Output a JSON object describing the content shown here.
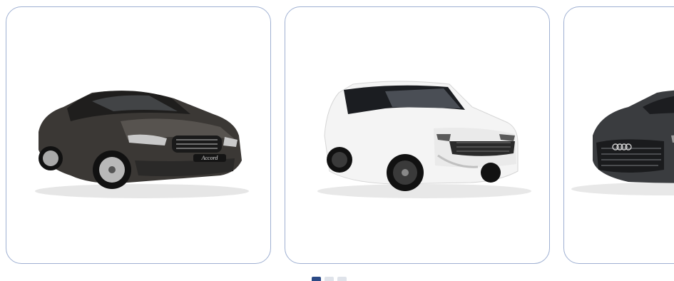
{
  "carousel": {
    "cards": [
      {
        "car": "honda-accord-sedan",
        "color": "#3b3835",
        "badge": "Accord"
      },
      {
        "car": "mitsubishi-outlander-suv",
        "color": "#f4f4f4"
      },
      {
        "car": "audi-q8-suv",
        "color": "#3a3c3f"
      }
    ],
    "pagination": {
      "total": 3,
      "active": 0
    }
  }
}
